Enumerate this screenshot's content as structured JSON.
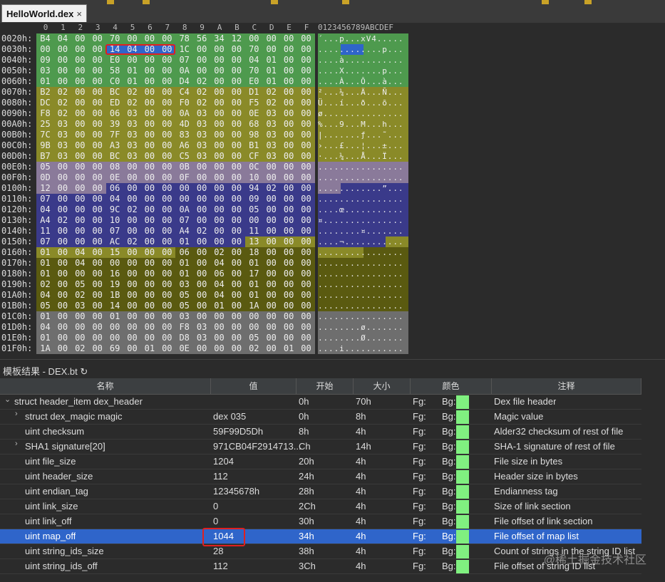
{
  "tab": {
    "title": "HelloWorld.dex",
    "close": "×"
  },
  "hex": {
    "column_headers": [
      "0",
      "1",
      "2",
      "3",
      "4",
      "5",
      "6",
      "7",
      "8",
      "9",
      "A",
      "B",
      "C",
      "D",
      "E",
      "F"
    ],
    "ascii_header": "0123456789ABCDEF",
    "rows": [
      {
        "addr": "0020h:",
        "bytes": [
          "B4",
          "04",
          "00",
          "00",
          "70",
          "00",
          "00",
          "00",
          "78",
          "56",
          "34",
          "12",
          "00",
          "00",
          "00",
          "00"
        ],
        "ascii": "´...p...xV4....."
      },
      {
        "addr": "0030h:",
        "bytes": [
          "00",
          "00",
          "00",
          "00",
          "14",
          "04",
          "00",
          "00",
          "1C",
          "00",
          "00",
          "00",
          "70",
          "00",
          "00",
          "00"
        ],
        "ascii": "............p..."
      },
      {
        "addr": "0040h:",
        "bytes": [
          "09",
          "00",
          "00",
          "00",
          "E0",
          "00",
          "00",
          "00",
          "07",
          "00",
          "00",
          "00",
          "04",
          "01",
          "00",
          "00"
        ],
        "ascii": "....à..........."
      },
      {
        "addr": "0050h:",
        "bytes": [
          "03",
          "00",
          "00",
          "00",
          "58",
          "01",
          "00",
          "00",
          "0A",
          "00",
          "00",
          "00",
          "70",
          "01",
          "00",
          "00"
        ],
        "ascii": "....X.......p..."
      },
      {
        "addr": "0060h:",
        "bytes": [
          "01",
          "00",
          "00",
          "00",
          "C0",
          "01",
          "00",
          "00",
          "D4",
          "02",
          "00",
          "00",
          "E0",
          "01",
          "00",
          "00"
        ],
        "ascii": "....À...Ô...à..."
      },
      {
        "addr": "0070h:",
        "bytes": [
          "B2",
          "02",
          "00",
          "00",
          "BC",
          "02",
          "00",
          "00",
          "C4",
          "02",
          "00",
          "00",
          "D1",
          "02",
          "00",
          "00"
        ],
        "ascii": "²...¼...Ä...Ñ..."
      },
      {
        "addr": "0080h:",
        "bytes": [
          "DC",
          "02",
          "00",
          "00",
          "ED",
          "02",
          "00",
          "00",
          "F0",
          "02",
          "00",
          "00",
          "F5",
          "02",
          "00",
          "00"
        ],
        "ascii": "Ü...í...ð...õ..."
      },
      {
        "addr": "0090h:",
        "bytes": [
          "F8",
          "02",
          "00",
          "00",
          "06",
          "03",
          "00",
          "00",
          "0A",
          "03",
          "00",
          "00",
          "0E",
          "03",
          "00",
          "00"
        ],
        "ascii": "ø..............."
      },
      {
        "addr": "00A0h:",
        "bytes": [
          "25",
          "03",
          "00",
          "00",
          "39",
          "03",
          "00",
          "00",
          "4D",
          "03",
          "00",
          "00",
          "68",
          "03",
          "00",
          "00"
        ],
        "ascii": "%...9...M...h..."
      },
      {
        "addr": "00B0h:",
        "bytes": [
          "7C",
          "03",
          "00",
          "00",
          "7F",
          "03",
          "00",
          "00",
          "83",
          "03",
          "00",
          "00",
          "98",
          "03",
          "00",
          "00"
        ],
        "ascii": "|.......ƒ...˜..."
      },
      {
        "addr": "00C0h:",
        "bytes": [
          "9B",
          "03",
          "00",
          "00",
          "A3",
          "03",
          "00",
          "00",
          "A6",
          "03",
          "00",
          "00",
          "B1",
          "03",
          "00",
          "00"
        ],
        "ascii": "›...£...¦...±..."
      },
      {
        "addr": "00D0h:",
        "bytes": [
          "B7",
          "03",
          "00",
          "00",
          "BC",
          "03",
          "00",
          "00",
          "C5",
          "03",
          "00",
          "00",
          "CF",
          "03",
          "00",
          "00"
        ],
        "ascii": "·...¼...Å...Ï..."
      },
      {
        "addr": "00E0h:",
        "bytes": [
          "05",
          "00",
          "00",
          "00",
          "08",
          "00",
          "00",
          "00",
          "0B",
          "00",
          "00",
          "00",
          "0C",
          "00",
          "00",
          "00"
        ],
        "ascii": "................"
      },
      {
        "addr": "00F0h:",
        "bytes": [
          "0D",
          "00",
          "00",
          "00",
          "0E",
          "00",
          "00",
          "00",
          "0F",
          "00",
          "00",
          "00",
          "10",
          "00",
          "00",
          "00"
        ],
        "ascii": "................"
      },
      {
        "addr": "0100h:",
        "bytes": [
          "12",
          "00",
          "00",
          "00",
          "06",
          "00",
          "00",
          "00",
          "00",
          "00",
          "00",
          "00",
          "94",
          "02",
          "00",
          "00"
        ],
        "ascii": "............”..."
      },
      {
        "addr": "0110h:",
        "bytes": [
          "07",
          "00",
          "00",
          "00",
          "04",
          "00",
          "00",
          "00",
          "00",
          "00",
          "00",
          "00",
          "09",
          "00",
          "00",
          "00"
        ],
        "ascii": "................"
      },
      {
        "addr": "0120h:",
        "bytes": [
          "04",
          "00",
          "00",
          "00",
          "9C",
          "02",
          "00",
          "00",
          "0A",
          "00",
          "00",
          "00",
          "05",
          "00",
          "00",
          "00"
        ],
        "ascii": "....œ..........."
      },
      {
        "addr": "0130h:",
        "bytes": [
          "A4",
          "02",
          "00",
          "00",
          "10",
          "00",
          "00",
          "00",
          "07",
          "00",
          "00",
          "00",
          "00",
          "00",
          "00",
          "00"
        ],
        "ascii": "¤..............."
      },
      {
        "addr": "0140h:",
        "bytes": [
          "11",
          "00",
          "00",
          "00",
          "07",
          "00",
          "00",
          "00",
          "A4",
          "02",
          "00",
          "00",
          "11",
          "00",
          "00",
          "00"
        ],
        "ascii": "........¤......."
      },
      {
        "addr": "0150h:",
        "bytes": [
          "07",
          "00",
          "00",
          "00",
          "AC",
          "02",
          "00",
          "00",
          "01",
          "00",
          "00",
          "00",
          "13",
          "00",
          "00",
          "00"
        ],
        "ascii": "....¬..........."
      },
      {
        "addr": "0160h:",
        "bytes": [
          "01",
          "00",
          "04",
          "00",
          "15",
          "00",
          "00",
          "00",
          "06",
          "00",
          "02",
          "00",
          "18",
          "00",
          "00",
          "00"
        ],
        "ascii": "................"
      },
      {
        "addr": "0170h:",
        "bytes": [
          "01",
          "00",
          "04",
          "00",
          "00",
          "00",
          "00",
          "00",
          "01",
          "00",
          "04",
          "00",
          "01",
          "00",
          "00",
          "00"
        ],
        "ascii": "................"
      },
      {
        "addr": "0180h:",
        "bytes": [
          "01",
          "00",
          "00",
          "00",
          "16",
          "00",
          "00",
          "00",
          "01",
          "00",
          "06",
          "00",
          "17",
          "00",
          "00",
          "00"
        ],
        "ascii": "................"
      },
      {
        "addr": "0190h:",
        "bytes": [
          "02",
          "00",
          "05",
          "00",
          "19",
          "00",
          "00",
          "00",
          "03",
          "00",
          "04",
          "00",
          "01",
          "00",
          "00",
          "00"
        ],
        "ascii": "................"
      },
      {
        "addr": "01A0h:",
        "bytes": [
          "04",
          "00",
          "02",
          "00",
          "1B",
          "00",
          "00",
          "00",
          "05",
          "00",
          "04",
          "00",
          "01",
          "00",
          "00",
          "00"
        ],
        "ascii": "................"
      },
      {
        "addr": "01B0h:",
        "bytes": [
          "05",
          "00",
          "03",
          "00",
          "14",
          "00",
          "00",
          "00",
          "05",
          "00",
          "01",
          "00",
          "1A",
          "00",
          "00",
          "00"
        ],
        "ascii": "................"
      },
      {
        "addr": "01C0h:",
        "bytes": [
          "01",
          "00",
          "00",
          "00",
          "01",
          "00",
          "00",
          "00",
          "03",
          "00",
          "00",
          "00",
          "00",
          "00",
          "00",
          "00"
        ],
        "ascii": "................"
      },
      {
        "addr": "01D0h:",
        "bytes": [
          "04",
          "00",
          "00",
          "00",
          "00",
          "00",
          "00",
          "00",
          "F8",
          "03",
          "00",
          "00",
          "00",
          "00",
          "00",
          "00"
        ],
        "ascii": "........ø......."
      },
      {
        "addr": "01E0h:",
        "bytes": [
          "01",
          "00",
          "00",
          "00",
          "00",
          "00",
          "00",
          "00",
          "D8",
          "03",
          "00",
          "00",
          "05",
          "00",
          "00",
          "00"
        ],
        "ascii": "........Ø......."
      },
      {
        "addr": "01F0h:",
        "bytes": [
          "1A",
          "00",
          "02",
          "00",
          "69",
          "00",
          "01",
          "00",
          "0E",
          "00",
          "00",
          "00",
          "02",
          "00",
          "01",
          "00"
        ],
        "ascii": "....i..........."
      }
    ]
  },
  "colors": {
    "green": "#4e9a4e",
    "olive": "#8a8a28",
    "purple": "#8a7a9a",
    "blue": "#3a3a8a",
    "darkolive": "#5a5a10",
    "grey": "#6e6e6e",
    "select": "#2f65ca"
  },
  "template": {
    "title": "模板结果 - DEX.bt",
    "refresh_icon": "↻",
    "headers": [
      "名称",
      "值",
      "开始",
      "大小",
      "颜色",
      "注释"
    ],
    "rows": [
      {
        "name": "struct header_item dex_header",
        "value": "",
        "start": "0h",
        "size": "70h",
        "fg": "Fg:",
        "bg": "Bg:",
        "comment": "Dex file header",
        "indent": 0,
        "expander": "⌄"
      },
      {
        "name": "struct dex_magic magic",
        "value": "dex 035",
        "start": "0h",
        "size": "8h",
        "fg": "Fg:",
        "bg": "Bg:",
        "comment": "Magic value",
        "indent": 1,
        "expander": "›"
      },
      {
        "name": "uint checksum",
        "value": "59F99D5Dh",
        "start": "8h",
        "size": "4h",
        "fg": "Fg:",
        "bg": "Bg:",
        "comment": "Alder32 checksum of rest of file",
        "indent": 1,
        "expander": ""
      },
      {
        "name": "SHA1 signature[20]",
        "value": "971CB04F2914713...",
        "start": "Ch",
        "size": "14h",
        "fg": "Fg:",
        "bg": "Bg:",
        "comment": "SHA-1 signature of rest of file",
        "indent": 1,
        "expander": "›"
      },
      {
        "name": "uint file_size",
        "value": "1204",
        "start": "20h",
        "size": "4h",
        "fg": "Fg:",
        "bg": "Bg:",
        "comment": "File size in bytes",
        "indent": 1,
        "expander": ""
      },
      {
        "name": "uint header_size",
        "value": "112",
        "start": "24h",
        "size": "4h",
        "fg": "Fg:",
        "bg": "Bg:",
        "comment": "Header size in bytes",
        "indent": 1,
        "expander": ""
      },
      {
        "name": "uint endian_tag",
        "value": "12345678h",
        "start": "28h",
        "size": "4h",
        "fg": "Fg:",
        "bg": "Bg:",
        "comment": "Endianness tag",
        "indent": 1,
        "expander": ""
      },
      {
        "name": "uint link_size",
        "value": "0",
        "start": "2Ch",
        "size": "4h",
        "fg": "Fg:",
        "bg": "Bg:",
        "comment": "Size of link section",
        "indent": 1,
        "expander": ""
      },
      {
        "name": "uint link_off",
        "value": "0",
        "start": "30h",
        "size": "4h",
        "fg": "Fg:",
        "bg": "Bg:",
        "comment": "File offset of link section",
        "indent": 1,
        "expander": ""
      },
      {
        "name": "uint map_off",
        "value": "1044",
        "start": "34h",
        "size": "4h",
        "fg": "Fg:",
        "bg": "Bg:",
        "comment": "File offset of map list",
        "indent": 1,
        "expander": "",
        "selected": true
      },
      {
        "name": "uint string_ids_size",
        "value": "28",
        "start": "38h",
        "size": "4h",
        "fg": "Fg:",
        "bg": "Bg:",
        "comment": "Count of strings in the string ID list",
        "indent": 1,
        "expander": ""
      },
      {
        "name": "uint string_ids_off",
        "value": "112",
        "start": "3Ch",
        "size": "4h",
        "fg": "Fg:",
        "bg": "Bg:",
        "comment": "File offset of string ID list",
        "indent": 1,
        "expander": ""
      }
    ]
  },
  "watermark": "@稀土掘金技术社区"
}
